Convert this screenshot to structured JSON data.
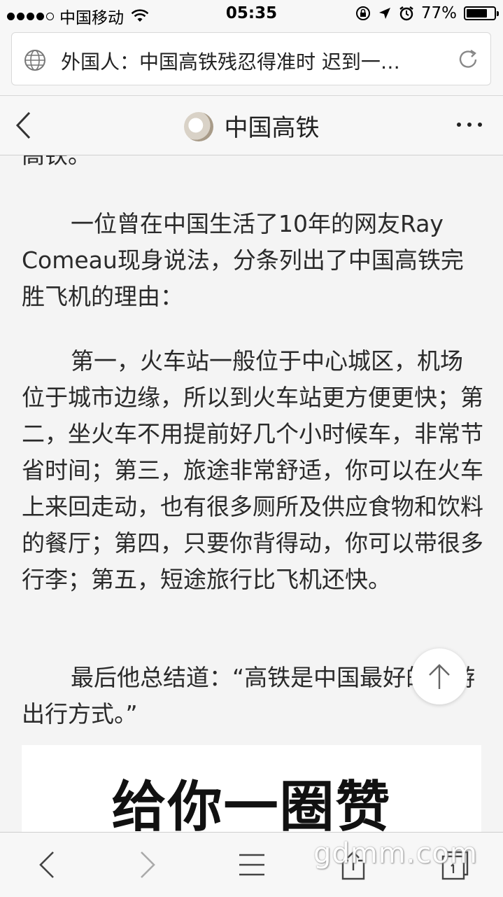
{
  "status_bar": {
    "carrier": "中国移动",
    "time": "05:35",
    "battery_percent": "77%",
    "battery_level": 0.77
  },
  "browser": {
    "url_title": "外国人：中国高铁残忍得准时 迟到一…"
  },
  "header": {
    "title": "中国高铁"
  },
  "article": {
    "p0": "高铁。",
    "p1": "一位曾在中国生活了10年的网友Ray Comeau现身说法，分条列出了中国高铁完胜飞机的理由：",
    "p2": "第一，火车站一般位于中心城区，机场位于城市边缘，所以到火车站更方便更快；第二，坐火车不用提前好几个小时候车，非常节省时间；第三，旅途非常舒适，你可以在火车上来回走动，也有很多厕所及供应食物和饮料的餐厅；第四，只要你背得动，你可以带很多行李；第五，短途旅行比飞机还快。",
    "p3": "最后他总结道：“高铁是中国最好的旅游出行方式。”",
    "image_text": "给你一圈赞"
  },
  "watermark": "gdmm.com"
}
